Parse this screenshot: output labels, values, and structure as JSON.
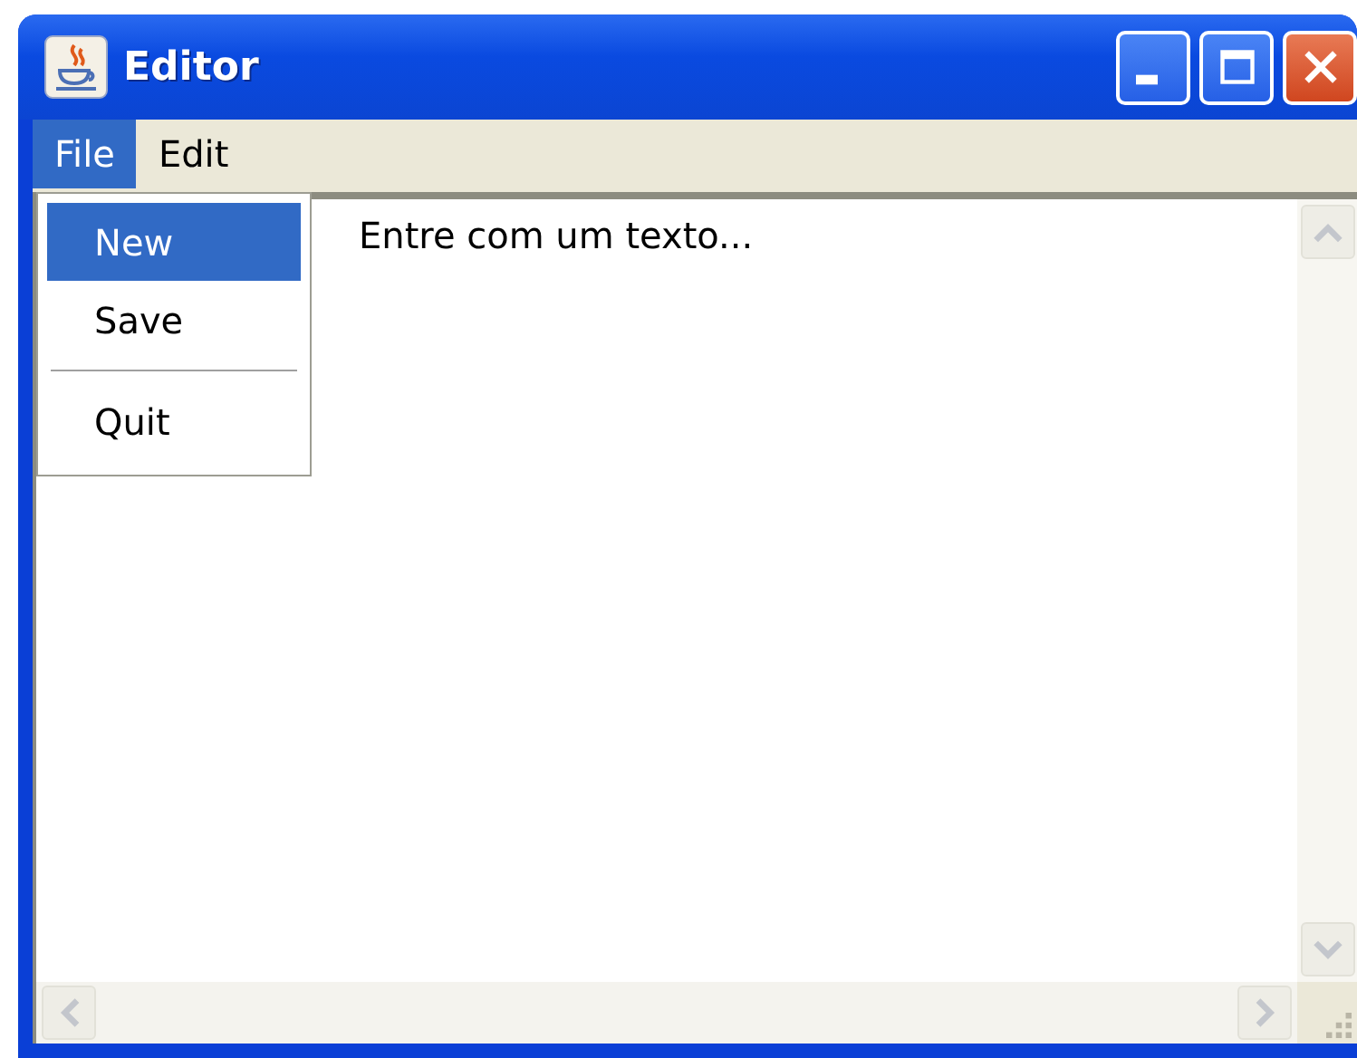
{
  "window": {
    "title": "Editor"
  },
  "menu_bar": [
    {
      "label": "File",
      "selected": true
    },
    {
      "label": "Edit",
      "selected": false
    }
  ],
  "menu": [
    {
      "kind": "item",
      "label": "New",
      "selected": true
    },
    {
      "kind": "item",
      "label": "Save",
      "selected": false
    },
    {
      "kind": "separator"
    },
    {
      "kind": "item",
      "label": "Quit",
      "selected": false
    }
  ],
  "text_area": {
    "value": "Entre com um texto..."
  }
}
